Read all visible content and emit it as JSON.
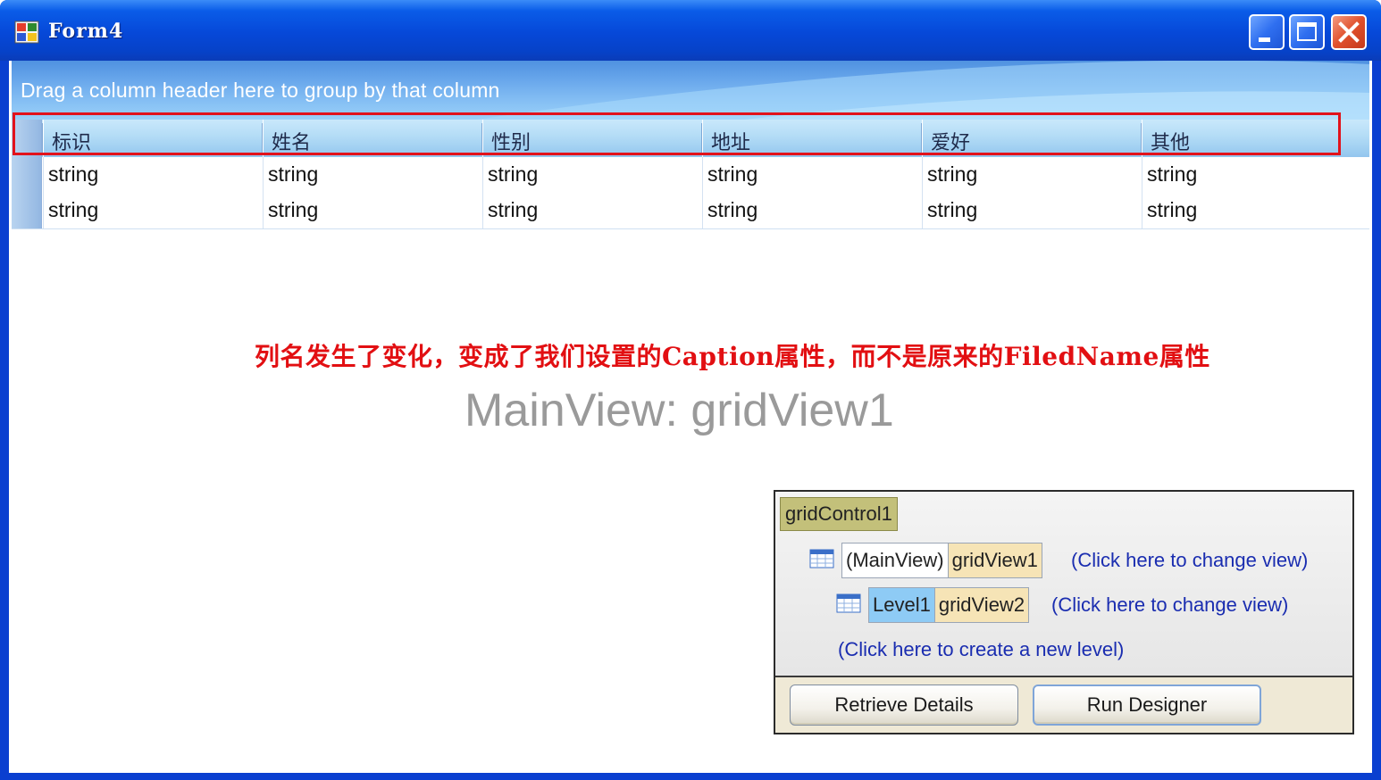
{
  "window": {
    "title": "Form4",
    "colors": {
      "titlebar": "#0648d8",
      "close": "#e0502c"
    }
  },
  "grid": {
    "group_panel_text": "Drag a column header here to group by that column",
    "columns": [
      "标识",
      "姓名",
      "性别",
      "地址",
      "爱好",
      "其他"
    ],
    "rows": [
      [
        "string",
        "string",
        "string",
        "string",
        "string",
        "string"
      ],
      [
        "string",
        "string",
        "string",
        "string",
        "string",
        "string"
      ]
    ]
  },
  "annotation": {
    "text": "列名发生了变化，变成了我们设置的Caption属性，而不是原来的FiledName属性",
    "color": "#e20f12"
  },
  "view_caption": "MainView: gridView1",
  "level_designer": {
    "root": "gridControl1",
    "main_view": {
      "prefix": "(MainView)",
      "name": "gridView1",
      "link": "(Click here to change view)"
    },
    "level1": {
      "prefix": "Level1",
      "name": "gridView2",
      "link": "(Click here to change view)"
    },
    "create_level_link": "(Click here to create a new level)",
    "buttons": {
      "retrieve_details": "Retrieve Details",
      "run_designer": "Run Designer"
    }
  },
  "icons": [
    "app-icon",
    "minimize-icon",
    "maximize-icon",
    "close-icon",
    "grid-view-icon"
  ]
}
